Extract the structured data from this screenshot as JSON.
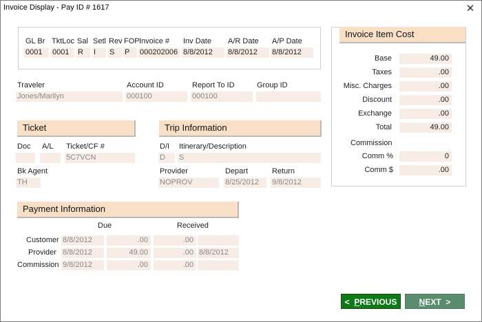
{
  "window": {
    "title": "Invoice Display - Pay ID # 1617",
    "close_glyph": "✕"
  },
  "header_grid": {
    "columns": [
      "GL Br",
      "TktLoc",
      "Sal",
      "Setl",
      "Rev",
      "FOP",
      "Invoice #",
      "Inv Date",
      "A/R Date",
      "A/P Date"
    ],
    "values": [
      "0001",
      "0001",
      "R",
      "I",
      "S",
      "P",
      "000202006",
      "8/8/2012",
      "8/8/2012",
      "8/8/2012"
    ]
  },
  "traveler": {
    "traveler_label": "Traveler",
    "traveler_value": "Jones/Marilyn",
    "account_label": "Account ID",
    "account_value": "000100",
    "report_label": "Report To ID",
    "report_value": "000100",
    "group_label": "Group ID",
    "group_value": ""
  },
  "ticket": {
    "title": "Ticket",
    "doc_label": "Doc",
    "al_label": "A/L",
    "tkt_label": "Ticket/CF #",
    "doc_value": "",
    "al_value": "",
    "tkt_value": "5C7VCN",
    "agent_label": "Bk Agent",
    "agent_value": "TH"
  },
  "trip": {
    "title": "Trip Information",
    "di_label": "D/I",
    "itin_label": "Itinerary/Description",
    "di_value": "D",
    "itin_value": "S",
    "provider_label": "Provider",
    "depart_label": "Depart",
    "return_label": "Return",
    "provider_value": "NOPROV",
    "depart_value": "8/25/2012",
    "return_value": "9/8/2012"
  },
  "payment": {
    "title": "Payment  Information",
    "due_label": "Due",
    "received_label": "Received",
    "rows": [
      {
        "label": "Customer",
        "due_date": "8/8/2012",
        "due_amt": ".00",
        "rec_amt": ".00",
        "rec_date": ""
      },
      {
        "label": "Provider",
        "due_date": "8/8/2012",
        "due_amt": "49.00",
        "rec_amt": ".00",
        "rec_date": "8/8/2012"
      },
      {
        "label": "Commission",
        "due_date": "9/8/2012",
        "due_amt": ".00",
        "rec_amt": ".00",
        "rec_date": ""
      }
    ]
  },
  "cost": {
    "title": "Invoice Item Cost",
    "rows": [
      {
        "label": "Base",
        "value": "49.00"
      },
      {
        "label": "Taxes",
        "value": ".00"
      },
      {
        "label": "Misc. Charges",
        "value": ".00"
      },
      {
        "label": "Discount",
        "value": ".00"
      },
      {
        "label": "Exchange",
        "value": ".00"
      },
      {
        "label": "Total",
        "value": "49.00"
      }
    ],
    "commission_label": "Commission",
    "comm_pct_label": "Comm %",
    "comm_pct_value": "0",
    "comm_amt_label": "Comm $",
    "comm_amt_value": ".00"
  },
  "buttons": {
    "prev_prefix": "<",
    "prev_underline": "P",
    "prev_rest": "REVIOUS",
    "next_underline": "N",
    "next_rest": "EXT",
    "next_suffix": ">"
  }
}
